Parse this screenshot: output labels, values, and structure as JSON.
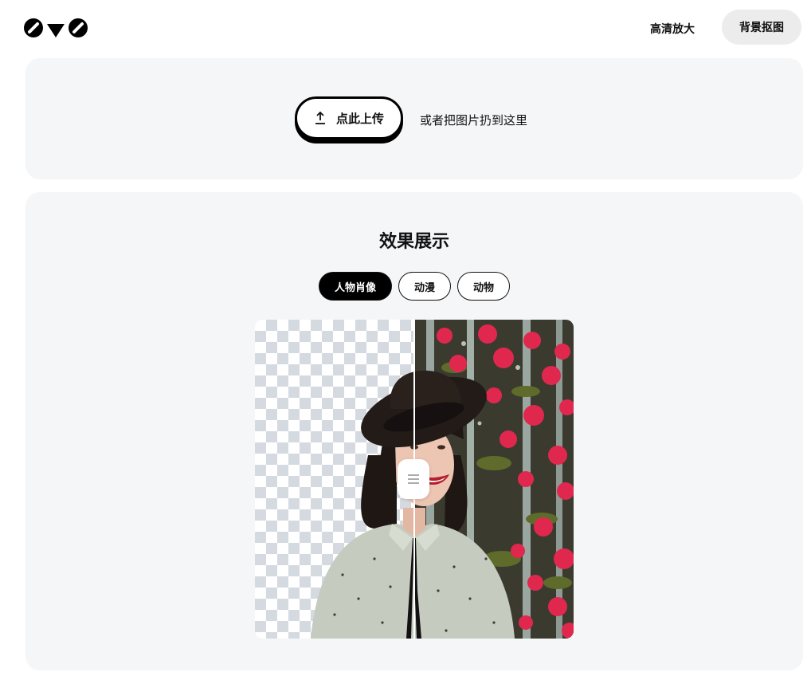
{
  "header": {
    "logo_icon": "owo-logo-icon",
    "nav": {
      "upscale": "高清放大",
      "remove_bg": "背景抠图"
    }
  },
  "upload": {
    "button_label": "点此上传",
    "button_icon": "upload-arrow-icon",
    "drop_hint": "或者把图片扔到这里"
  },
  "demo": {
    "title": "效果展示",
    "tabs": [
      {
        "label": "人物肖像",
        "active": true
      },
      {
        "label": "动漫",
        "active": false
      },
      {
        "label": "动物",
        "active": false
      }
    ],
    "compare": {
      "split_fraction": 0.5,
      "handle_icon": "drag-handle-lines-icon"
    }
  },
  "colors": {
    "card_bg": "#f5f6f8",
    "active_tab_bg": "#000000",
    "checker": "#d5d9e0",
    "flower": "#e0284e"
  }
}
